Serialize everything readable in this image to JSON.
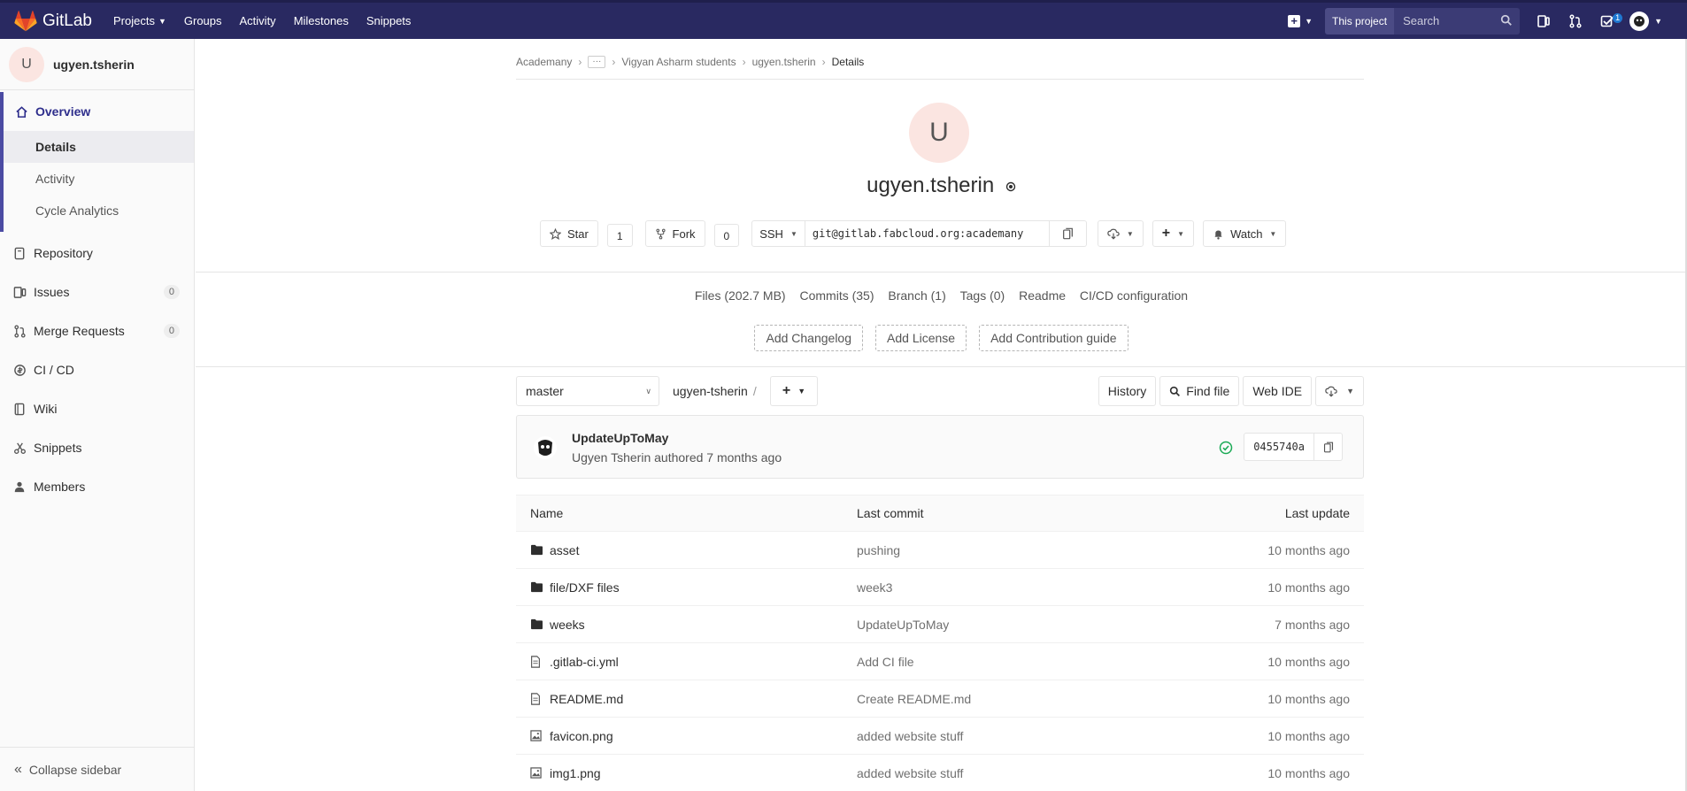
{
  "topbar": {
    "brand": "GitLab",
    "nav": [
      "Projects",
      "Groups",
      "Activity",
      "Milestones",
      "Snippets"
    ],
    "search_scope": "This project",
    "search_placeholder": "Search",
    "todo_count": "1"
  },
  "sidebar": {
    "avatar_letter": "U",
    "project_name": "ugyen.tsherin",
    "overview_label": "Overview",
    "overview_sub": [
      "Details",
      "Activity",
      "Cycle Analytics"
    ],
    "items": [
      {
        "label": "Repository",
        "icon": "book-icon"
      },
      {
        "label": "Issues",
        "icon": "issues-icon",
        "count": "0"
      },
      {
        "label": "Merge Requests",
        "icon": "merge-request-icon",
        "count": "0"
      },
      {
        "label": "CI / CD",
        "icon": "rocket-icon"
      },
      {
        "label": "Wiki",
        "icon": "book-icon"
      },
      {
        "label": "Snippets",
        "icon": "scissors-icon"
      },
      {
        "label": "Members",
        "icon": "users-icon"
      }
    ],
    "collapse_label": "Collapse sidebar"
  },
  "breadcrumb": {
    "items": [
      "Academany",
      "Vigyan Asharm students",
      "ugyen.tsherin"
    ],
    "current": "Details"
  },
  "project": {
    "avatar_letter": "U",
    "title": "ugyen.tsherin",
    "star_label": "Star",
    "star_count": "1",
    "fork_label": "Fork",
    "fork_count": "0",
    "clone_protocol": "SSH",
    "clone_url": "git@gitlab.fabcloud.org:academany",
    "watch_label": "Watch"
  },
  "stats": {
    "files": "Files (202.7 MB)",
    "commits": "Commits (35)",
    "branch": "Branch (1)",
    "tags": "Tags (0)",
    "readme": "Readme",
    "cicd": "CI/CD configuration"
  },
  "add_buttons": [
    "Add Changelog",
    "Add License",
    "Add Contribution guide"
  ],
  "tree": {
    "branch": "master",
    "path": "ugyen-tsherin",
    "path_sep": "/",
    "history": "History",
    "find_file": "Find file",
    "web_ide": "Web IDE"
  },
  "last_commit": {
    "title": "UpdateUpToMay",
    "meta": "Ugyen Tsherin authored 7 months ago",
    "sha": "0455740a"
  },
  "files": {
    "headers": {
      "name": "Name",
      "last_commit": "Last commit",
      "last_update": "Last update"
    },
    "rows": [
      {
        "name": "asset",
        "type": "folder",
        "commit": "pushing",
        "updated": "10 months ago"
      },
      {
        "name": "file/DXF files",
        "type": "folder",
        "commit": "week3",
        "updated": "10 months ago"
      },
      {
        "name": "weeks",
        "type": "folder",
        "commit": "UpdateUpToMay",
        "updated": "7 months ago"
      },
      {
        "name": ".gitlab-ci.yml",
        "type": "file",
        "commit": "Add CI file",
        "updated": "10 months ago"
      },
      {
        "name": "README.md",
        "type": "file",
        "commit": "Create README.md",
        "updated": "10 months ago"
      },
      {
        "name": "favicon.png",
        "type": "image",
        "commit": "added website stuff",
        "updated": "10 months ago"
      },
      {
        "name": "img1.png",
        "type": "image",
        "commit": "added website stuff",
        "updated": "10 months ago"
      }
    ]
  },
  "colors": {
    "nav_bg": "#292961",
    "accent": "#4b4ba3",
    "success": "#1aaa55"
  }
}
